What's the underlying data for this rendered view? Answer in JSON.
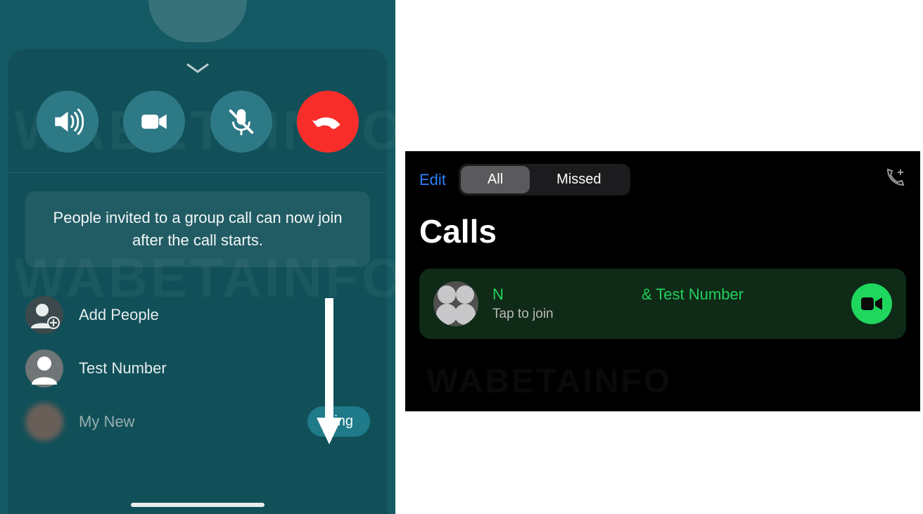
{
  "watermark": "WABETAINFO",
  "left": {
    "info_text": "People invited to a group call can now join after the call starts.",
    "controls": {
      "speaker": "speaker",
      "video": "video",
      "mute": "mute",
      "end": "end"
    },
    "rows": {
      "add_people": "Add People",
      "test_number": "Test Number",
      "my_new": "My New"
    },
    "ring_label": "Ring"
  },
  "right": {
    "edit_label": "Edit",
    "segments": {
      "all": "All",
      "missed": "Missed"
    },
    "title": "Calls",
    "card": {
      "name_part1": "N",
      "name_part2": "& Test Number",
      "subtitle": "Tap to join"
    }
  }
}
